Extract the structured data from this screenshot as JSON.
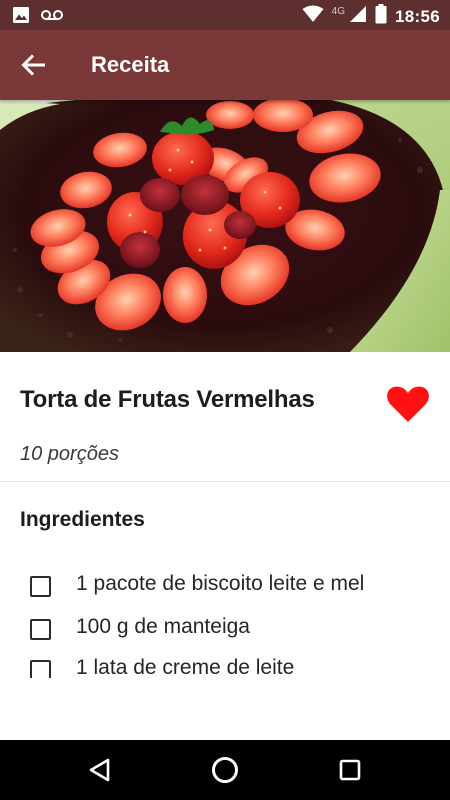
{
  "status_bar": {
    "time": "18:56",
    "network_type": "4G",
    "icons": [
      "image-icon",
      "voicemail-icon",
      "wifi-icon",
      "signal-icon",
      "battery-icon"
    ]
  },
  "app_bar": {
    "title": "Receita",
    "back_icon": "arrow-left-icon"
  },
  "hero_image": {
    "subject": "Torta de Frutas Vermelhas"
  },
  "recipe": {
    "title": "Torta de Frutas Vermelhas",
    "servings": "10 porções",
    "favorite_icon": "heart-icon",
    "favorited": true
  },
  "ingredients": {
    "section_title": "Ingredientes",
    "items": [
      {
        "label": "1 pacote de biscoito leite e mel",
        "checked": false
      },
      {
        "label": "100 g de manteiga",
        "checked": false
      },
      {
        "label": "1 lata de creme de leite",
        "checked": false
      }
    ]
  },
  "nav_bar": {
    "icons": [
      "back-triangle-icon",
      "home-circle-icon",
      "recents-square-icon"
    ]
  },
  "colors": {
    "status_bar": "#5e2f2f",
    "app_bar": "#7b3838",
    "heart": "#ff1111",
    "nav_bar": "#000000"
  }
}
